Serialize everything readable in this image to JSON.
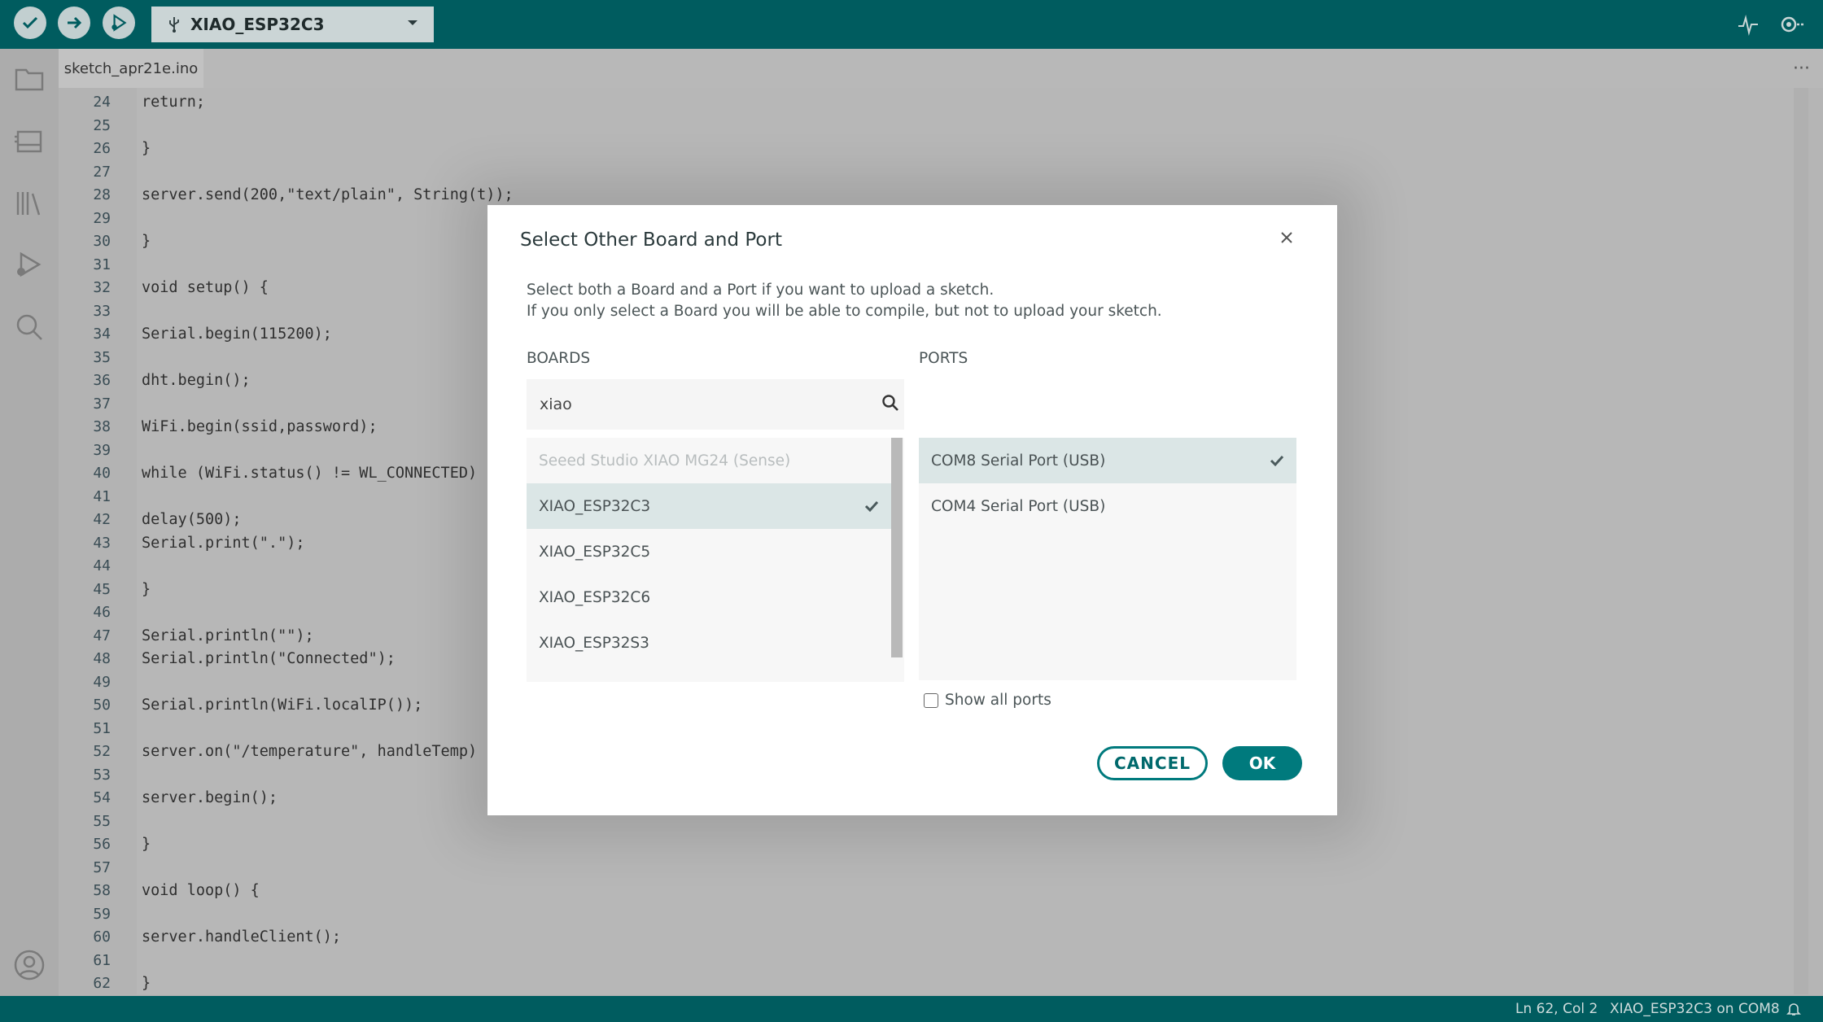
{
  "toolbar": {
    "board_name": "XIAO_ESP32C3",
    "icons": [
      "verify-icon",
      "upload-icon",
      "debug-icon",
      "usb-icon",
      "chevron-down-icon",
      "serial-plotter-icon",
      "serial-monitor-icon"
    ]
  },
  "sidebar": {
    "icons": [
      "sketchbook-icon",
      "boards-manager-icon",
      "library-manager-icon",
      "debug-icon",
      "search-icon",
      "account-icon"
    ]
  },
  "editor": {
    "tab_name": "sketch_apr21e.ino",
    "lines": [
      {
        "n": "24",
        "text": "return;"
      },
      {
        "n": "25",
        "text": ""
      },
      {
        "n": "26",
        "text": "}"
      },
      {
        "n": "27",
        "text": ""
      },
      {
        "n": "28",
        "text": "server.send(200,\"text/plain\", String(t));"
      },
      {
        "n": "29",
        "text": ""
      },
      {
        "n": "30",
        "text": "}"
      },
      {
        "n": "31",
        "text": ""
      },
      {
        "n": "32",
        "text": "void setup() {"
      },
      {
        "n": "33",
        "text": ""
      },
      {
        "n": "34",
        "text": "Serial.begin(115200);"
      },
      {
        "n": "35",
        "text": ""
      },
      {
        "n": "36",
        "text": "dht.begin();"
      },
      {
        "n": "37",
        "text": ""
      },
      {
        "n": "38",
        "text": "WiFi.begin(ssid,password);"
      },
      {
        "n": "39",
        "text": ""
      },
      {
        "n": "40",
        "text": "while (WiFi.status() != WL_CONNECTED)"
      },
      {
        "n": "41",
        "text": ""
      },
      {
        "n": "42",
        "text": "delay(500);"
      },
      {
        "n": "43",
        "text": "Serial.print(\".\");"
      },
      {
        "n": "44",
        "text": ""
      },
      {
        "n": "45",
        "text": "}"
      },
      {
        "n": "46",
        "text": ""
      },
      {
        "n": "47",
        "text": "Serial.println(\"\");"
      },
      {
        "n": "48",
        "text": "Serial.println(\"Connected\");"
      },
      {
        "n": "49",
        "text": ""
      },
      {
        "n": "50",
        "text": "Serial.println(WiFi.localIP());"
      },
      {
        "n": "51",
        "text": ""
      },
      {
        "n": "52",
        "text": "server.on(\"/temperature\", handleTemp)"
      },
      {
        "n": "53",
        "text": ""
      },
      {
        "n": "54",
        "text": "server.begin();"
      },
      {
        "n": "55",
        "text": ""
      },
      {
        "n": "56",
        "text": "}"
      },
      {
        "n": "57",
        "text": ""
      },
      {
        "n": "58",
        "text": "void loop() {"
      },
      {
        "n": "59",
        "text": ""
      },
      {
        "n": "60",
        "text": "server.handleClient();"
      },
      {
        "n": "61",
        "text": ""
      },
      {
        "n": "62",
        "text": "}"
      }
    ]
  },
  "dialog": {
    "title": "Select Other Board and Port",
    "desc_line1": "Select both a Board and a Port if you want to upload a sketch.",
    "desc_line2": "If you only select a Board you will be able to compile, but not to upload your sketch.",
    "boards_label": "BOARDS",
    "ports_label": "PORTS",
    "search_value": "xiao",
    "boards": [
      {
        "label": "Seeed Studio XIAO MG24 (Sense)",
        "state": "disabled"
      },
      {
        "label": "XIAO_ESP32C3",
        "state": "selected"
      },
      {
        "label": "XIAO_ESP32C5",
        "state": "normal"
      },
      {
        "label": "XIAO_ESP32C6",
        "state": "normal"
      },
      {
        "label": "XIAO_ESP32S3",
        "state": "normal"
      }
    ],
    "ports": [
      {
        "label": "COM8 Serial Port (USB)",
        "state": "selected"
      },
      {
        "label": "COM4 Serial Port (USB)",
        "state": "normal"
      }
    ],
    "show_all_ports": "Show all ports",
    "cancel_label": "CANCEL",
    "ok_label": "OK"
  },
  "status": {
    "position": "Ln 62, Col 2",
    "board_port": "XIAO_ESP32C3 on COM8"
  },
  "colors": {
    "accent": "#005c5f",
    "button": "#007a7d"
  }
}
